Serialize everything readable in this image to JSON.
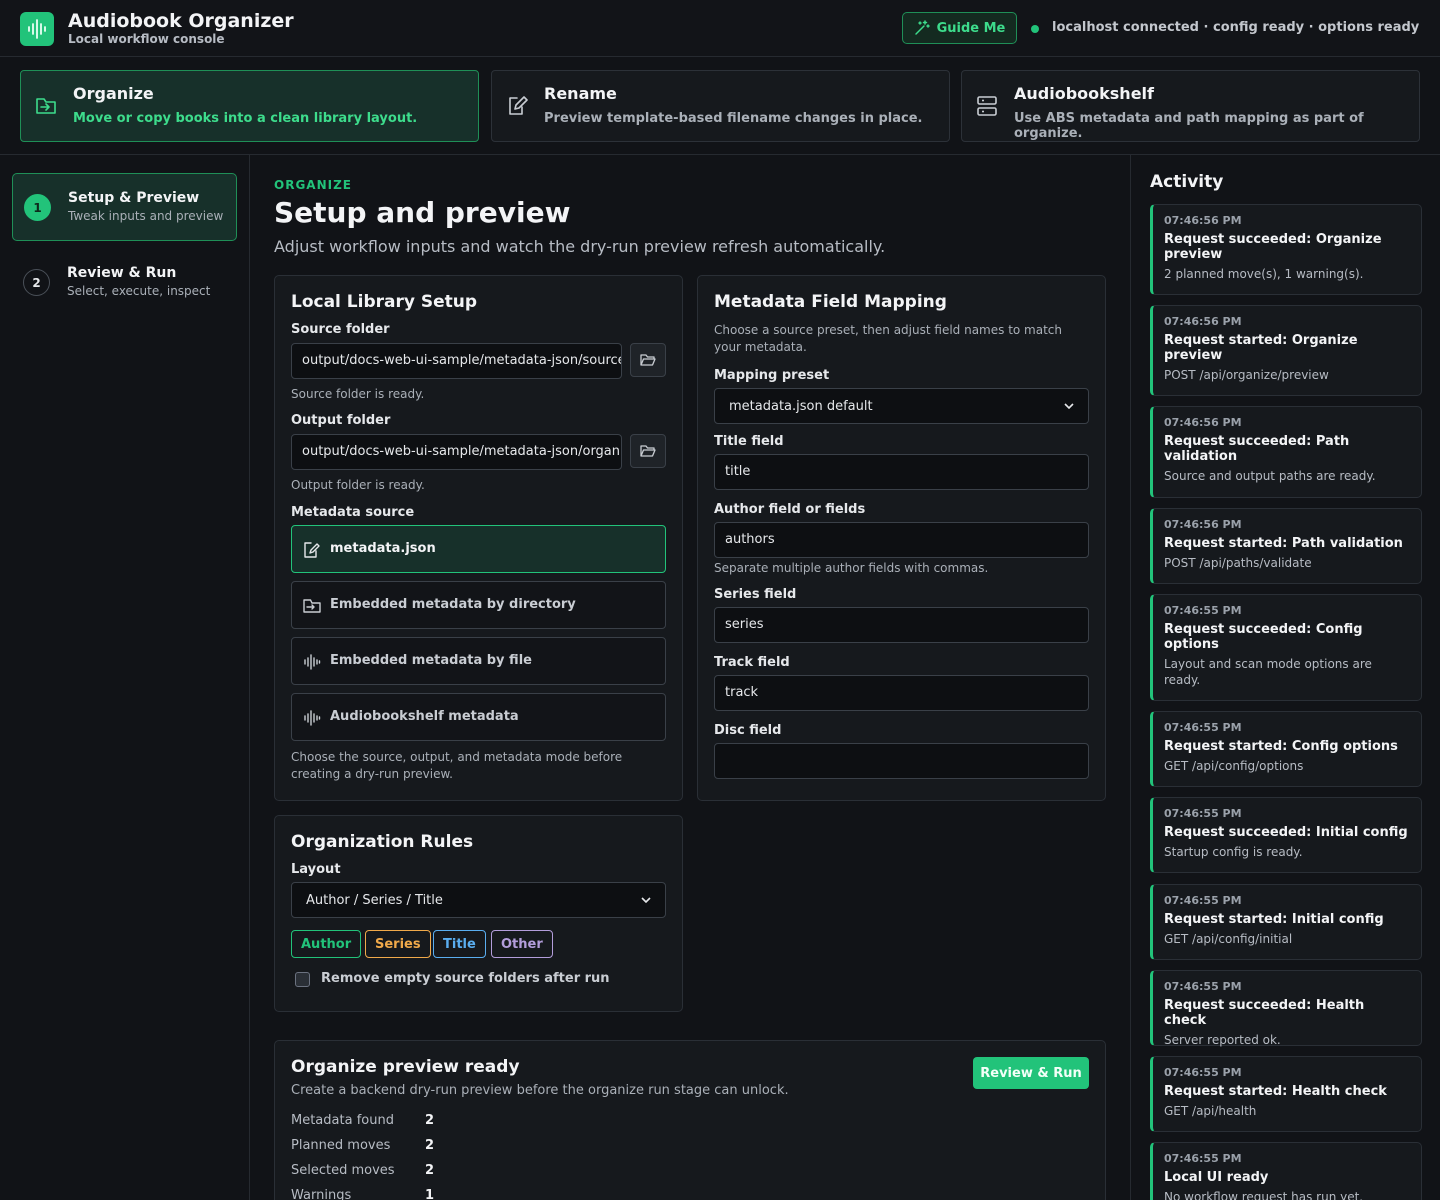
{
  "header": {
    "app_title": "Audiobook Organizer",
    "app_subtitle": "Local workflow console",
    "guide_label": "Guide Me",
    "status_text": "localhost connected · config ready · options ready"
  },
  "modes": [
    {
      "title": "Organize",
      "desc": "Move or copy books into a clean library layout.",
      "icon": "folder-move-icon",
      "active": true
    },
    {
      "title": "Rename",
      "desc": "Preview template-based filename changes in place.",
      "icon": "edit-file-icon",
      "active": false
    },
    {
      "title": "Audiobookshelf",
      "desc": "Use ABS metadata and path mapping as part of organize.",
      "icon": "server-icon",
      "active": false
    }
  ],
  "steps": [
    {
      "num": "1",
      "title": "Setup & Preview",
      "sub": "Tweak inputs and preview"
    },
    {
      "num": "2",
      "title": "Review & Run",
      "sub": "Select, execute, inspect"
    }
  ],
  "main": {
    "eyebrow": "ORGANIZE",
    "title": "Setup and preview",
    "desc": "Adjust workflow inputs and watch the dry-run preview refresh automatically."
  },
  "library": {
    "title": "Local Library Setup",
    "source_label": "Source folder",
    "source_value": "output/docs-web-ui-sample/metadata-json/source",
    "source_hint": "Source folder is ready.",
    "output_label": "Output folder",
    "output_value": "output/docs-web-ui-sample/metadata-json/organized",
    "output_hint": "Output folder is ready.",
    "metadata_label": "Metadata source",
    "options": [
      "metadata.json",
      "Embedded metadata by directory",
      "Embedded metadata by file",
      "Audiobookshelf metadata"
    ],
    "footer_hint": "Choose the source, output, and metadata mode before creating a dry-run preview."
  },
  "mapping": {
    "title": "Metadata Field Mapping",
    "desc": "Choose a source preset, then adjust field names to match your metadata.",
    "preset_label": "Mapping preset",
    "preset_value": "metadata.json default",
    "title_label": "Title field",
    "title_value": "title",
    "author_label": "Author field or fields",
    "author_value": "authors",
    "author_hint": "Separate multiple author fields with commas.",
    "series_label": "Series field",
    "series_value": "series",
    "track_label": "Track field",
    "track_value": "track",
    "disc_label": "Disc field",
    "disc_value": ""
  },
  "rules": {
    "title": "Organization Rules",
    "layout_label": "Layout",
    "layout_value": "Author / Series / Title",
    "chips": [
      {
        "label": "Author",
        "color": "#22c37a"
      },
      {
        "label": "Series",
        "color": "#f0a94a"
      },
      {
        "label": "Title",
        "color": "#5aaef0"
      },
      {
        "label": "Other",
        "color": "#b39ddb"
      }
    ],
    "remove_empty_label": "Remove empty source folders after run"
  },
  "preview": {
    "title": "Organize preview ready",
    "desc": "Create a backend dry-run preview before the organize run stage can unlock.",
    "button": "Review & Run",
    "stats": [
      {
        "label": "Metadata found",
        "value": "2"
      },
      {
        "label": "Planned moves",
        "value": "2"
      },
      {
        "label": "Selected moves",
        "value": "2"
      },
      {
        "label": "Warnings",
        "value": "1"
      }
    ]
  },
  "activity": {
    "title": "Activity",
    "items": [
      {
        "time": "07:46:56 PM",
        "head": "Request succeeded: Organize preview",
        "detail": "2 planned move(s), 1 warning(s)."
      },
      {
        "time": "07:46:56 PM",
        "head": "Request started: Organize preview",
        "detail": "POST /api/organize/preview"
      },
      {
        "time": "07:46:56 PM",
        "head": "Request succeeded: Path validation",
        "detail": "Source and output paths are ready."
      },
      {
        "time": "07:46:56 PM",
        "head": "Request started: Path validation",
        "detail": "POST /api/paths/validate"
      },
      {
        "time": "07:46:55 PM",
        "head": "Request succeeded: Config options",
        "detail": "Layout and scan mode options are ready."
      },
      {
        "time": "07:46:55 PM",
        "head": "Request started: Config options",
        "detail": "GET /api/config/options"
      },
      {
        "time": "07:46:55 PM",
        "head": "Request succeeded: Initial config",
        "detail": "Startup config is ready."
      },
      {
        "time": "07:46:55 PM",
        "head": "Request started: Initial config",
        "detail": "GET /api/config/initial"
      },
      {
        "time": "07:46:55 PM",
        "head": "Request succeeded: Health check",
        "detail": "Server reported ok."
      },
      {
        "time": "07:46:55 PM",
        "head": "Request started: Health check",
        "detail": "GET /api/health"
      },
      {
        "time": "07:46:55 PM",
        "head": "Local UI ready",
        "detail": "No workflow request has run yet."
      }
    ]
  },
  "colors": {
    "accent": "#22c37a",
    "background": "#111317"
  }
}
